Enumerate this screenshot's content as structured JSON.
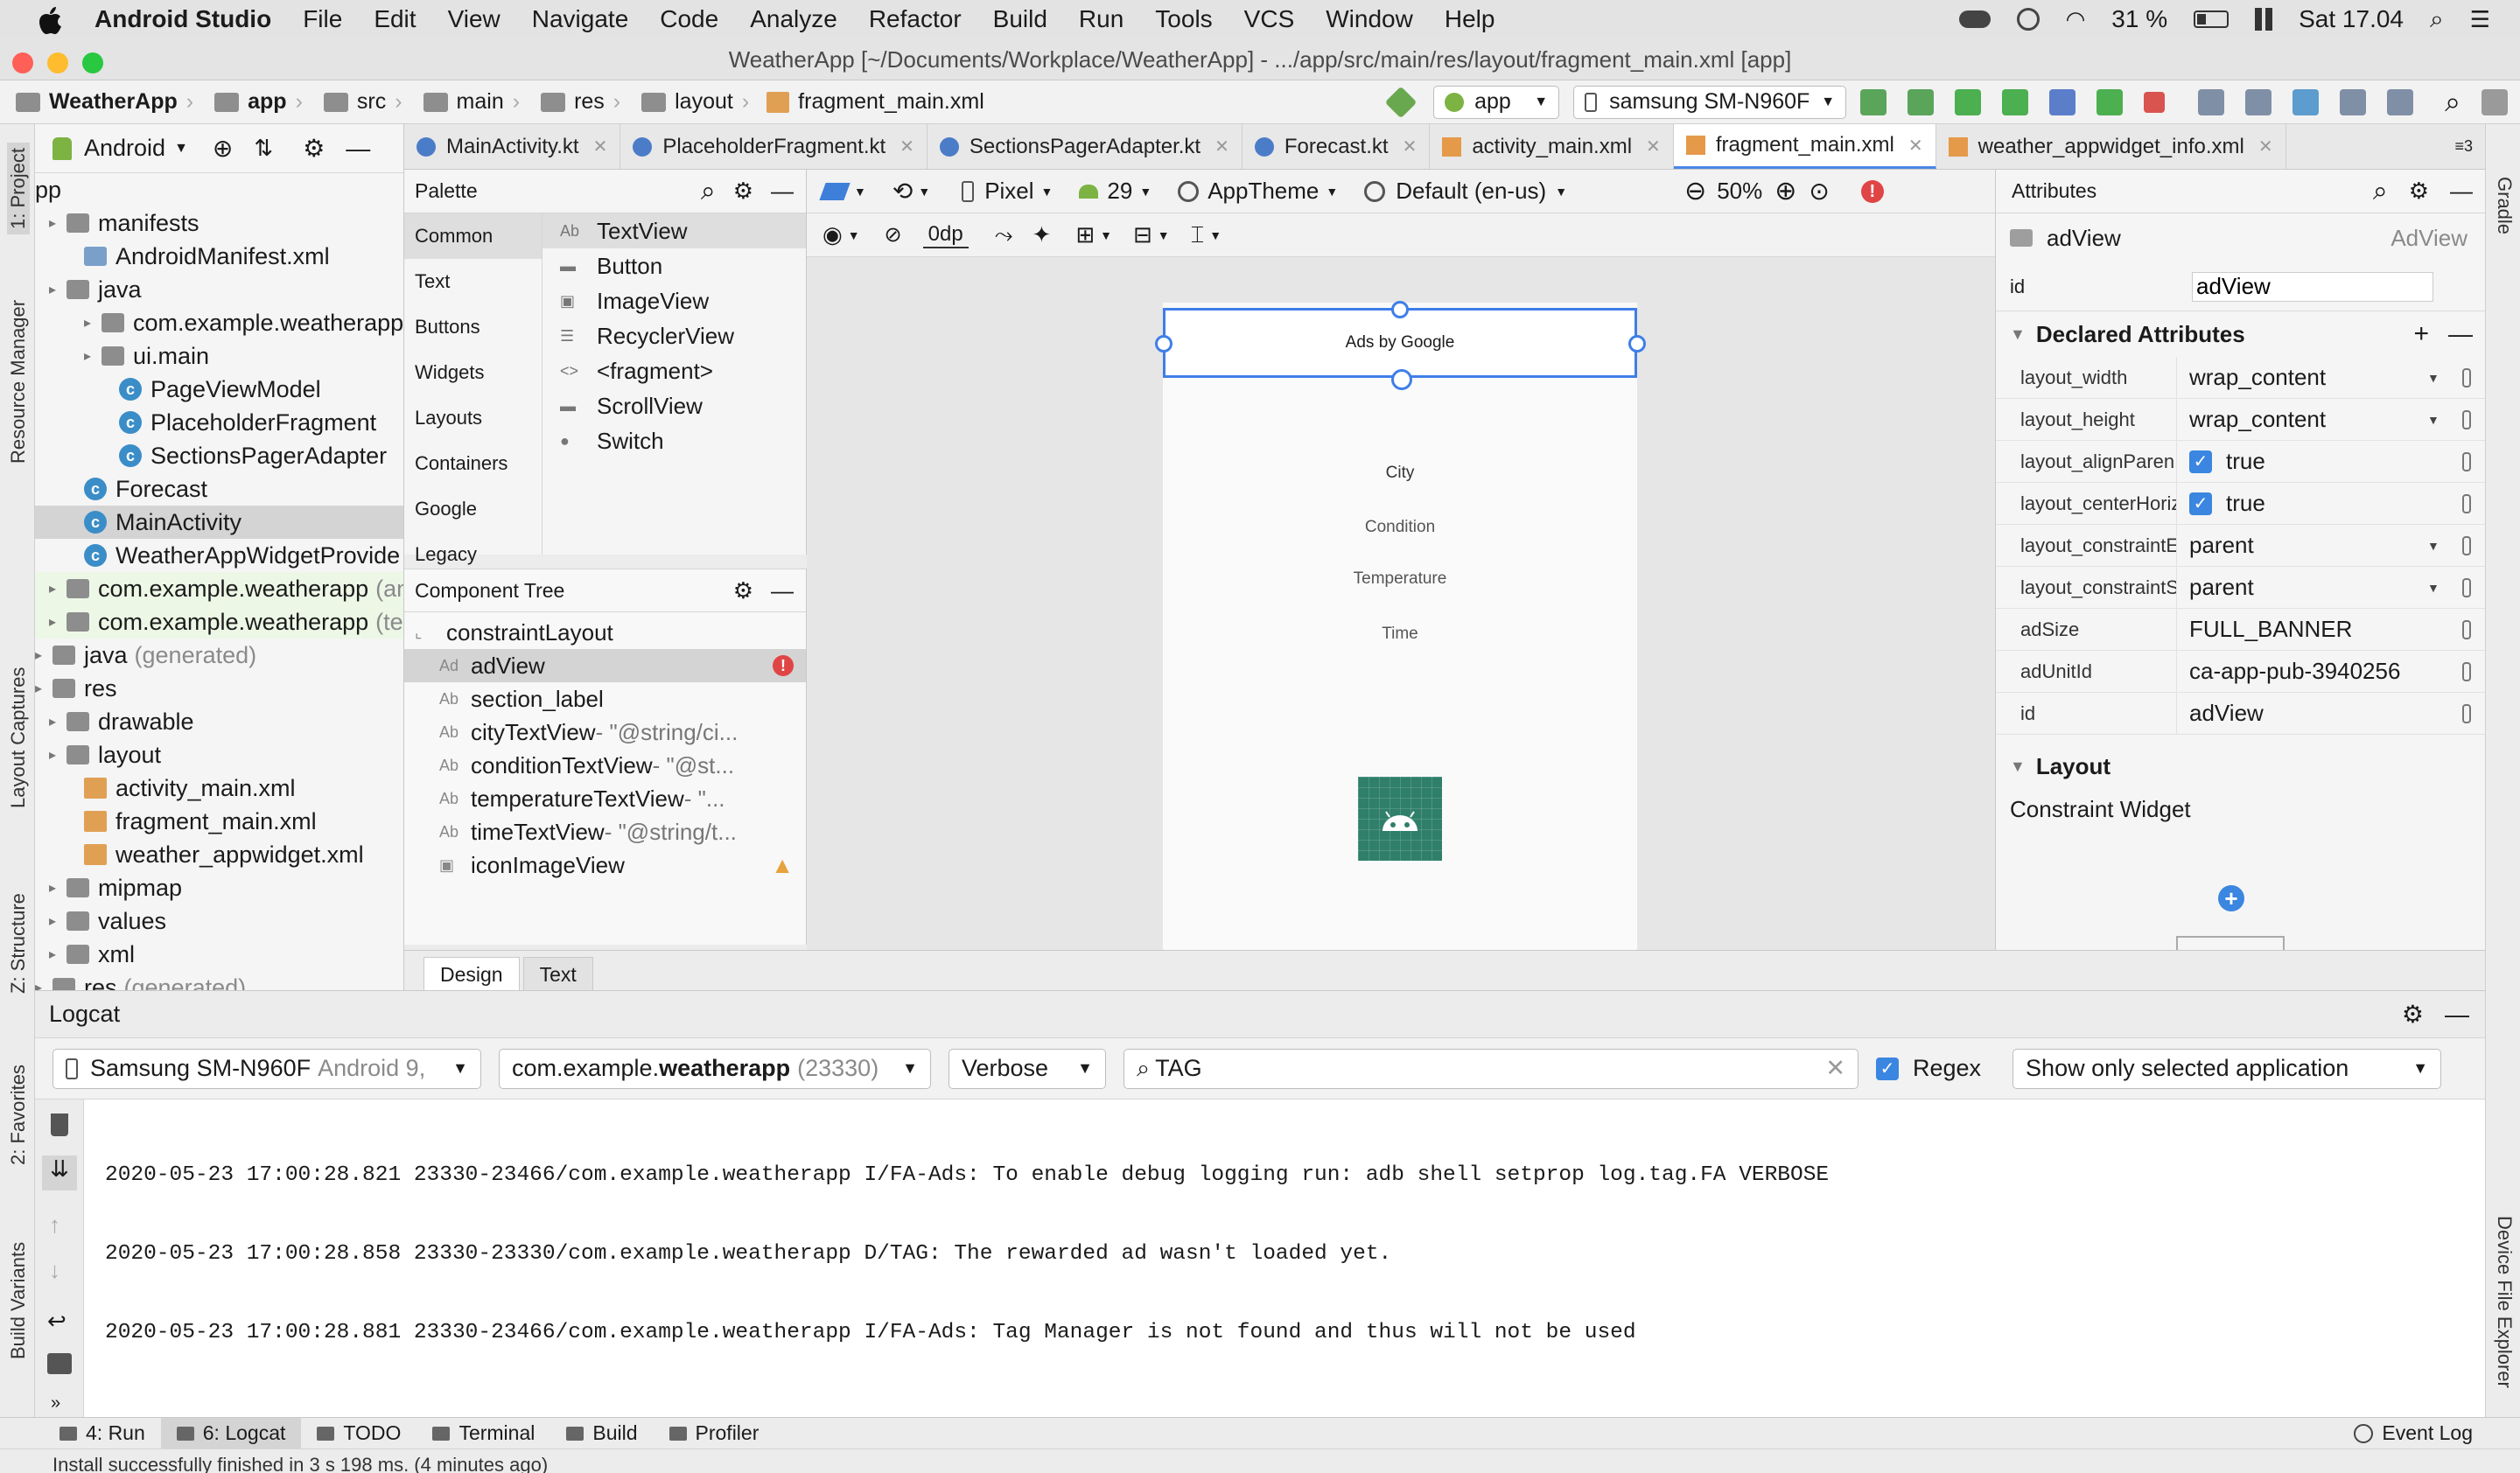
{
  "menubar": {
    "app_name": "Android Studio",
    "items": [
      "File",
      "Edit",
      "View",
      "Navigate",
      "Code",
      "Analyze",
      "Refactor",
      "Build",
      "Run",
      "Tools",
      "VCS",
      "Window",
      "Help"
    ],
    "battery": "31 %",
    "clock": "Sat 17.04"
  },
  "window": {
    "title": "WeatherApp [~/Documents/Workplace/WeatherApp] - .../app/src/main/res/layout/fragment_main.xml [app]"
  },
  "navbar": {
    "breadcrumbs": [
      "WeatherApp",
      "app",
      "src",
      "main",
      "res",
      "layout",
      "fragment_main.xml"
    ],
    "run_config": "app",
    "device": "samsung SM-N960F"
  },
  "side_tools": {
    "left": [
      "1: Project",
      "Resource Manager",
      "Layout Captures",
      "Z: Structure",
      "2: Favorites",
      "Build Variants"
    ],
    "right": [
      "Gradle",
      "Device File Explorer"
    ]
  },
  "project": {
    "view": "Android",
    "tree": [
      {
        "label": "pp",
        "depth": 0,
        "type": "root"
      },
      {
        "label": "manifests",
        "depth": 1,
        "type": "folder"
      },
      {
        "label": "AndroidManifest.xml",
        "depth": 2,
        "type": "manifest"
      },
      {
        "label": "java",
        "depth": 1,
        "type": "folder"
      },
      {
        "label": "com.example.weatherapp",
        "depth": 2,
        "type": "folder"
      },
      {
        "label": "ui.main",
        "depth": 2,
        "type": "folder"
      },
      {
        "label": "PageViewModel",
        "depth": 3,
        "type": "class"
      },
      {
        "label": "PlaceholderFragment",
        "depth": 3,
        "type": "class"
      },
      {
        "label": "SectionsPagerAdapter",
        "depth": 3,
        "type": "class"
      },
      {
        "label": "Forecast",
        "depth": 2,
        "type": "class"
      },
      {
        "label": "MainActivity",
        "depth": 2,
        "type": "class",
        "selected": true
      },
      {
        "label": "WeatherAppWidgetProvide",
        "depth": 2,
        "type": "class"
      },
      {
        "label": "com.example.weatherapp",
        "suffix": "(an",
        "depth": 1,
        "type": "folder",
        "green": true
      },
      {
        "label": "com.example.weatherapp",
        "suffix": "(tes",
        "depth": 1,
        "type": "folder",
        "green": true
      },
      {
        "label": "java",
        "suffix": "(generated)",
        "depth": 0,
        "type": "folder"
      },
      {
        "label": "res",
        "depth": 0,
        "type": "folder"
      },
      {
        "label": "drawable",
        "depth": 1,
        "type": "folder"
      },
      {
        "label": "layout",
        "depth": 1,
        "type": "folder"
      },
      {
        "label": "activity_main.xml",
        "depth": 2,
        "type": "xml"
      },
      {
        "label": "fragment_main.xml",
        "depth": 2,
        "type": "xml"
      },
      {
        "label": "weather_appwidget.xml",
        "depth": 2,
        "type": "xml"
      },
      {
        "label": "mipmap",
        "depth": 1,
        "type": "folder"
      },
      {
        "label": "values",
        "depth": 1,
        "type": "folder"
      },
      {
        "label": "xml",
        "depth": 1,
        "type": "folder"
      },
      {
        "label": "res",
        "suffix": "(generated)",
        "depth": 0,
        "type": "folder"
      }
    ]
  },
  "editor_tabs": [
    {
      "label": "MainActivity.kt",
      "kind": "kt"
    },
    {
      "label": "PlaceholderFragment.kt",
      "kind": "kt"
    },
    {
      "label": "SectionsPagerAdapter.kt",
      "kind": "kt"
    },
    {
      "label": "Forecast.kt",
      "kind": "kt"
    },
    {
      "label": "activity_main.xml",
      "kind": "xml"
    },
    {
      "label": "fragment_main.xml",
      "kind": "xml",
      "active": true
    },
    {
      "label": "weather_appwidget_info.xml",
      "kind": "xml"
    }
  ],
  "tab_overflow": "3",
  "palette": {
    "title": "Palette",
    "categories": [
      "Common",
      "Text",
      "Buttons",
      "Widgets",
      "Layouts",
      "Containers",
      "Google",
      "Legacy"
    ],
    "items": [
      "TextView",
      "Button",
      "ImageView",
      "RecyclerView",
      "<fragment>",
      "ScrollView",
      "Switch"
    ]
  },
  "component_tree": {
    "title": "Component Tree",
    "items": [
      {
        "label": "constraintLayout",
        "hint": "",
        "depth": 0
      },
      {
        "label": "adView",
        "hint": "",
        "depth": 1,
        "selected": true,
        "badge": "error"
      },
      {
        "label": "section_label",
        "hint": "",
        "depth": 1
      },
      {
        "label": "cityTextView",
        "hint": "- \"@string/ci...",
        "depth": 1
      },
      {
        "label": "conditionTextView",
        "hint": "- \"@st...",
        "depth": 1
      },
      {
        "label": "temperatureTextView",
        "hint": "- \"...",
        "depth": 1
      },
      {
        "label": "timeTextView",
        "hint": "- \"@string/t...",
        "depth": 1
      },
      {
        "label": "iconImageView",
        "hint": "",
        "depth": 1,
        "badge": "warning"
      }
    ]
  },
  "design_toolbar": {
    "device": "Pixel",
    "api": "29",
    "theme": "AppTheme",
    "locale": "Default (en-us)",
    "zoom": "50%",
    "margin": "0dp"
  },
  "preview": {
    "ad_text": "Ads by Google",
    "texts": [
      "City",
      "Condition",
      "Temperature",
      "Time"
    ]
  },
  "attributes": {
    "title": "Attributes",
    "component_name": "adView",
    "component_type": "AdView",
    "id_value": "adView",
    "declared_title": "Declared Attributes",
    "declared": [
      {
        "key": "layout_width",
        "value": "wrap_content",
        "dropdown": true
      },
      {
        "key": "layout_height",
        "value": "wrap_content",
        "dropdown": true
      },
      {
        "key": "layout_alignParen",
        "value": "true",
        "checkbox": true
      },
      {
        "key": "layout_centerHoriz",
        "value": "true",
        "checkbox": true
      },
      {
        "key": "layout_constraintE",
        "value": "parent",
        "dropdown": true
      },
      {
        "key": "layout_constraintS",
        "value": "parent",
        "dropdown": true
      },
      {
        "key": "adSize",
        "value": "FULL_BANNER"
      },
      {
        "key": "adUnitId",
        "value": "ca-app-pub-3940256"
      },
      {
        "key": "id",
        "value": "adView"
      }
    ],
    "layout_title": "Layout",
    "layout_type": "Constraint Widget"
  },
  "design_tabs": [
    "Design",
    "Text"
  ],
  "logcat": {
    "title": "Logcat",
    "device": "Samsung SM-N960F",
    "device_suffix": "Android 9,",
    "process_prefix": "com.example.",
    "process_bold": "weatherapp",
    "process_pid": "(23330)",
    "level": "Verbose",
    "search": "TAG",
    "regex_label": "Regex",
    "filter": "Show only selected application",
    "lines": [
      "2020-05-23 17:00:28.821 23330-23466/com.example.weatherapp I/FA-Ads: To enable debug logging run: adb shell setprop log.tag.FA VERBOSE",
      "2020-05-23 17:00:28.858 23330-23330/com.example.weatherapp D/TAG: The rewarded ad wasn't loaded yet.",
      "2020-05-23 17:00:28.881 23330-23466/com.example.weatherapp I/FA-Ads: Tag Manager is not found and thus will not be used"
    ]
  },
  "bottom_tools": [
    {
      "label": "4: Run"
    },
    {
      "label": "6: Logcat",
      "active": true
    },
    {
      "label": "TODO"
    },
    {
      "label": "Terminal"
    },
    {
      "label": "Build"
    },
    {
      "label": "Profiler"
    }
  ],
  "event_log": "Event Log",
  "status": "Install successfully finished in 3 s 198 ms. (4 minutes ago)"
}
